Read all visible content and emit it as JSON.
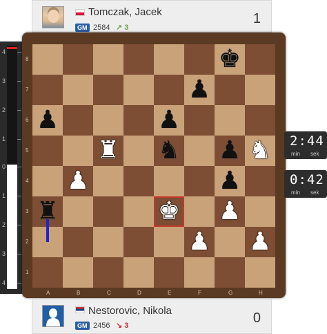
{
  "players": {
    "top": {
      "name": "Tomczak, Jacek",
      "title": "GM",
      "rating": "2584",
      "trend_arrow": "↗",
      "trend_value": "3",
      "score": "1"
    },
    "bottom": {
      "name": "Nestorovic, Nikola",
      "title": "GM",
      "rating": "2456",
      "trend_arrow": "↘",
      "trend_value": "3",
      "score": "0"
    }
  },
  "clocks": {
    "top": {
      "time": "2:44",
      "min_label": "min",
      "sek_label": "sek"
    },
    "bottom": {
      "time": "0:42",
      "min_label": "min",
      "sek_label": "sek"
    }
  },
  "eval_bar": {
    "ticks_top": [
      "4",
      "3",
      "2",
      "1"
    ],
    "center": "0",
    "ticks_bottom": [
      "1",
      "2",
      "3",
      "4"
    ],
    "evaluation": 0.1
  },
  "board": {
    "files": [
      "A",
      "B",
      "C",
      "D",
      "E",
      "F",
      "G",
      "H"
    ],
    "ranks": [
      "8",
      "7",
      "6",
      "5",
      "4",
      "3",
      "2",
      "1"
    ],
    "highlight": "e3",
    "pieces": [
      {
        "square": "g8",
        "type": "king",
        "color": "black",
        "glyph": "♚"
      },
      {
        "square": "f7",
        "type": "pawn",
        "color": "black",
        "glyph": "♟"
      },
      {
        "square": "a6",
        "type": "pawn",
        "color": "black",
        "glyph": "♟"
      },
      {
        "square": "e6",
        "type": "pawn",
        "color": "black",
        "glyph": "♟"
      },
      {
        "square": "c5",
        "type": "rook",
        "color": "white",
        "glyph": "♜"
      },
      {
        "square": "e5",
        "type": "knight",
        "color": "black",
        "glyph": "♞"
      },
      {
        "square": "g5",
        "type": "pawn",
        "color": "black",
        "glyph": "♟"
      },
      {
        "square": "h5",
        "type": "knight",
        "color": "white",
        "glyph": "♞"
      },
      {
        "square": "b4",
        "type": "pawn",
        "color": "white",
        "glyph": "♟"
      },
      {
        "square": "g4",
        "type": "pawn",
        "color": "black",
        "glyph": "♟"
      },
      {
        "square": "a3",
        "type": "rook",
        "color": "black",
        "glyph": "♜"
      },
      {
        "square": "e3",
        "type": "king",
        "color": "white",
        "glyph": "♚"
      },
      {
        "square": "g3",
        "type": "pawn",
        "color": "white",
        "glyph": "♟"
      },
      {
        "square": "f2",
        "type": "pawn",
        "color": "white",
        "glyph": "♟"
      },
      {
        "square": "h2",
        "type": "pawn",
        "color": "white",
        "glyph": "♟"
      }
    ],
    "arrow": {
      "from": "a3",
      "to": "a2",
      "color": "#2222cc"
    }
  },
  "colors": {
    "light_square": "#caa27a",
    "dark_square": "#7d4e33",
    "frame": "#5a3a22",
    "highlight": "#c0392b",
    "title_badge": "#2b5ea8"
  }
}
